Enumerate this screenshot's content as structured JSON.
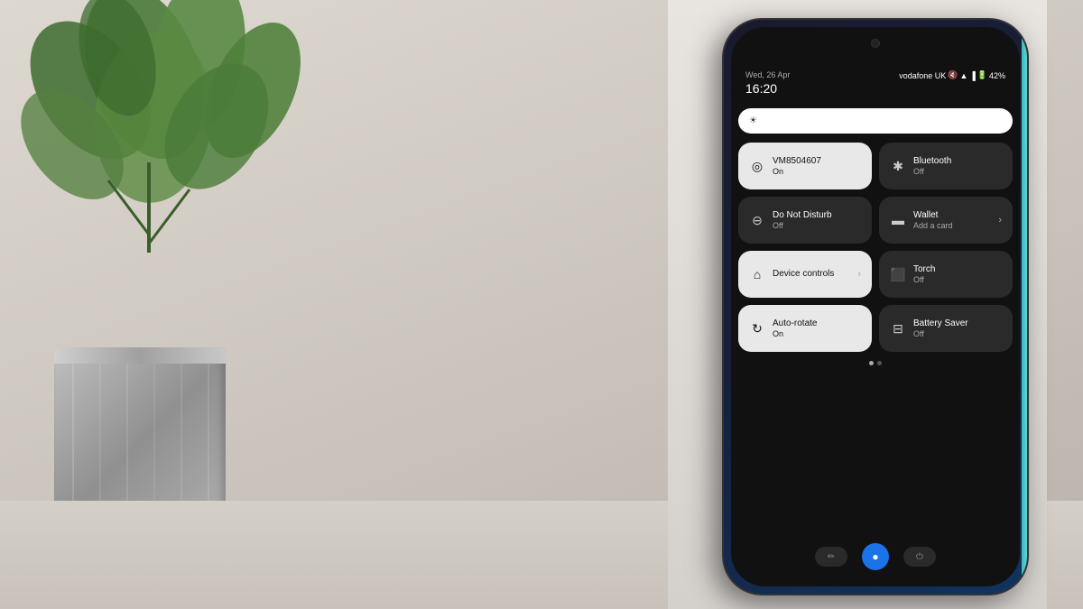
{
  "scene": {
    "background_color": "#c8c0b8"
  },
  "status_bar": {
    "date": "Wed, 26 Apr",
    "time": "16:20",
    "carrier": "vodafone UK",
    "battery": "42%",
    "icons": [
      "mute",
      "wifi",
      "signal",
      "battery"
    ]
  },
  "brightness": {
    "label": "☀"
  },
  "tiles": [
    {
      "id": "wifi",
      "icon": "⊙",
      "label": "VM8504607",
      "sub": "On",
      "active": true,
      "has_arrow": false
    },
    {
      "id": "bluetooth",
      "icon": "✱",
      "label": "Bluetooth",
      "sub": "Off",
      "active": false,
      "has_arrow": false
    },
    {
      "id": "do-not-disturb",
      "icon": "⊖",
      "label": "Do Not Disturb",
      "sub": "Off",
      "active": false,
      "has_arrow": false
    },
    {
      "id": "wallet",
      "icon": "▬",
      "label": "Wallet",
      "sub": "Add a card",
      "active": false,
      "has_arrow": true
    },
    {
      "id": "device-controls",
      "icon": "⌂",
      "label": "Device controls",
      "sub": "",
      "active": true,
      "has_arrow": true
    },
    {
      "id": "torch",
      "icon": "▮",
      "label": "Torch",
      "sub": "Off",
      "active": false,
      "has_arrow": false
    },
    {
      "id": "auto-rotate",
      "icon": "↻",
      "label": "Auto-rotate",
      "sub": "On",
      "active": true,
      "has_arrow": false
    },
    {
      "id": "battery-saver",
      "icon": "⊟",
      "label": "Battery Saver",
      "sub": "Off",
      "active": false,
      "has_arrow": false
    }
  ],
  "nav_buttons": [
    {
      "id": "back",
      "icon": "✏"
    },
    {
      "id": "home",
      "icon": "●"
    },
    {
      "id": "recents",
      "icon": "⏻"
    }
  ],
  "pagination_dots": [
    {
      "active": true
    },
    {
      "active": false
    }
  ]
}
